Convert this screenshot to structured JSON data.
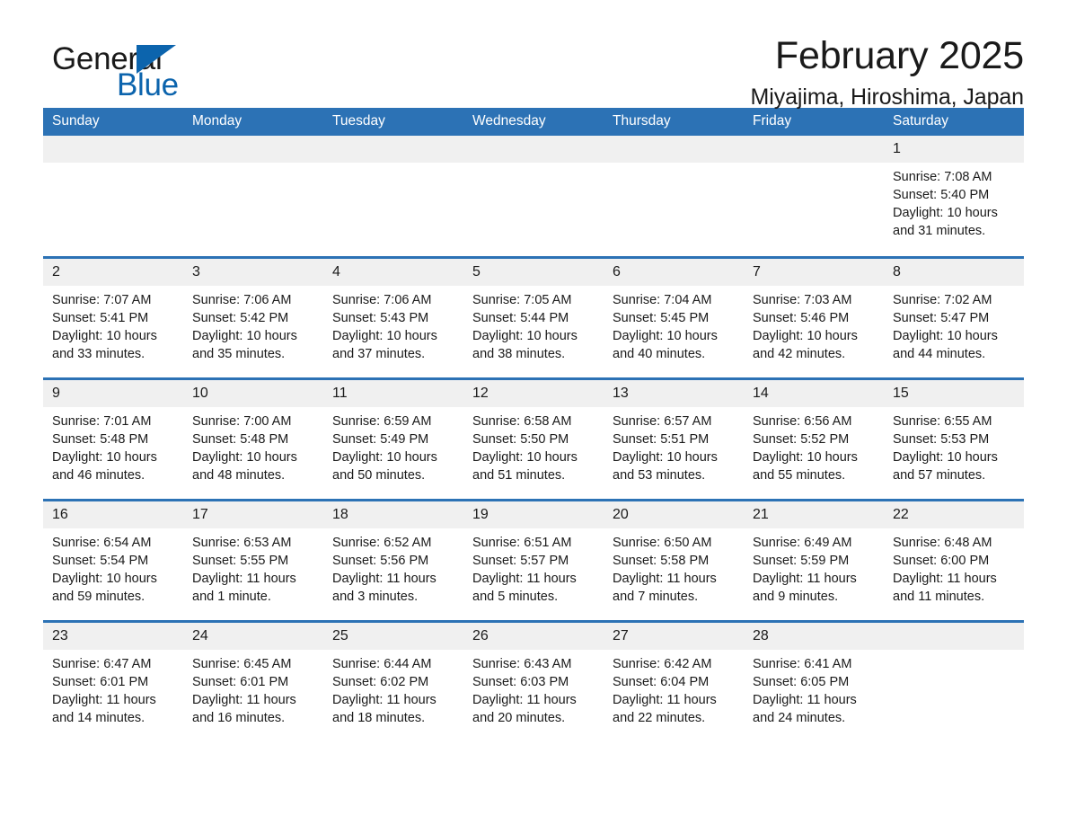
{
  "brand": {
    "word_one": "General",
    "word_two": "Blue",
    "triangle_color": "#0c64ad",
    "icon": "general-blue-logo"
  },
  "header": {
    "month_title": "February 2025",
    "location": "Miyajima, Hiroshima, Japan"
  },
  "theme": {
    "accent_blue": "#2c72b5",
    "logo_blue": "#0c64ad",
    "daynum_band": "#f0f0f0",
    "text": "#1a1a1a"
  },
  "weekdays": [
    "Sunday",
    "Monday",
    "Tuesday",
    "Wednesday",
    "Thursday",
    "Friday",
    "Saturday"
  ],
  "labels": {
    "sunrise_prefix": "Sunrise:",
    "sunset_prefix": "Sunset:",
    "daylight_prefix": "Daylight:"
  },
  "weeks": [
    [
      {
        "day": "",
        "blank": true
      },
      {
        "day": "",
        "blank": true
      },
      {
        "day": "",
        "blank": true
      },
      {
        "day": "",
        "blank": true
      },
      {
        "day": "",
        "blank": true
      },
      {
        "day": "",
        "blank": true
      },
      {
        "day": "1",
        "sunrise": "Sunrise: 7:08 AM",
        "sunset": "Sunset: 5:40 PM",
        "daylight": "Daylight: 10 hours and 31 minutes."
      }
    ],
    [
      {
        "day": "2",
        "sunrise": "Sunrise: 7:07 AM",
        "sunset": "Sunset: 5:41 PM",
        "daylight": "Daylight: 10 hours and 33 minutes."
      },
      {
        "day": "3",
        "sunrise": "Sunrise: 7:06 AM",
        "sunset": "Sunset: 5:42 PM",
        "daylight": "Daylight: 10 hours and 35 minutes."
      },
      {
        "day": "4",
        "sunrise": "Sunrise: 7:06 AM",
        "sunset": "Sunset: 5:43 PM",
        "daylight": "Daylight: 10 hours and 37 minutes."
      },
      {
        "day": "5",
        "sunrise": "Sunrise: 7:05 AM",
        "sunset": "Sunset: 5:44 PM",
        "daylight": "Daylight: 10 hours and 38 minutes."
      },
      {
        "day": "6",
        "sunrise": "Sunrise: 7:04 AM",
        "sunset": "Sunset: 5:45 PM",
        "daylight": "Daylight: 10 hours and 40 minutes."
      },
      {
        "day": "7",
        "sunrise": "Sunrise: 7:03 AM",
        "sunset": "Sunset: 5:46 PM",
        "daylight": "Daylight: 10 hours and 42 minutes."
      },
      {
        "day": "8",
        "sunrise": "Sunrise: 7:02 AM",
        "sunset": "Sunset: 5:47 PM",
        "daylight": "Daylight: 10 hours and 44 minutes."
      }
    ],
    [
      {
        "day": "9",
        "sunrise": "Sunrise: 7:01 AM",
        "sunset": "Sunset: 5:48 PM",
        "daylight": "Daylight: 10 hours and 46 minutes."
      },
      {
        "day": "10",
        "sunrise": "Sunrise: 7:00 AM",
        "sunset": "Sunset: 5:48 PM",
        "daylight": "Daylight: 10 hours and 48 minutes."
      },
      {
        "day": "11",
        "sunrise": "Sunrise: 6:59 AM",
        "sunset": "Sunset: 5:49 PM",
        "daylight": "Daylight: 10 hours and 50 minutes."
      },
      {
        "day": "12",
        "sunrise": "Sunrise: 6:58 AM",
        "sunset": "Sunset: 5:50 PM",
        "daylight": "Daylight: 10 hours and 51 minutes."
      },
      {
        "day": "13",
        "sunrise": "Sunrise: 6:57 AM",
        "sunset": "Sunset: 5:51 PM",
        "daylight": "Daylight: 10 hours and 53 minutes."
      },
      {
        "day": "14",
        "sunrise": "Sunrise: 6:56 AM",
        "sunset": "Sunset: 5:52 PM",
        "daylight": "Daylight: 10 hours and 55 minutes."
      },
      {
        "day": "15",
        "sunrise": "Sunrise: 6:55 AM",
        "sunset": "Sunset: 5:53 PM",
        "daylight": "Daylight: 10 hours and 57 minutes."
      }
    ],
    [
      {
        "day": "16",
        "sunrise": "Sunrise: 6:54 AM",
        "sunset": "Sunset: 5:54 PM",
        "daylight": "Daylight: 10 hours and 59 minutes."
      },
      {
        "day": "17",
        "sunrise": "Sunrise: 6:53 AM",
        "sunset": "Sunset: 5:55 PM",
        "daylight": "Daylight: 11 hours and 1 minute."
      },
      {
        "day": "18",
        "sunrise": "Sunrise: 6:52 AM",
        "sunset": "Sunset: 5:56 PM",
        "daylight": "Daylight: 11 hours and 3 minutes."
      },
      {
        "day": "19",
        "sunrise": "Sunrise: 6:51 AM",
        "sunset": "Sunset: 5:57 PM",
        "daylight": "Daylight: 11 hours and 5 minutes."
      },
      {
        "day": "20",
        "sunrise": "Sunrise: 6:50 AM",
        "sunset": "Sunset: 5:58 PM",
        "daylight": "Daylight: 11 hours and 7 minutes."
      },
      {
        "day": "21",
        "sunrise": "Sunrise: 6:49 AM",
        "sunset": "Sunset: 5:59 PM",
        "daylight": "Daylight: 11 hours and 9 minutes."
      },
      {
        "day": "22",
        "sunrise": "Sunrise: 6:48 AM",
        "sunset": "Sunset: 6:00 PM",
        "daylight": "Daylight: 11 hours and 11 minutes."
      }
    ],
    [
      {
        "day": "23",
        "sunrise": "Sunrise: 6:47 AM",
        "sunset": "Sunset: 6:01 PM",
        "daylight": "Daylight: 11 hours and 14 minutes."
      },
      {
        "day": "24",
        "sunrise": "Sunrise: 6:45 AM",
        "sunset": "Sunset: 6:01 PM",
        "daylight": "Daylight: 11 hours and 16 minutes."
      },
      {
        "day": "25",
        "sunrise": "Sunrise: 6:44 AM",
        "sunset": "Sunset: 6:02 PM",
        "daylight": "Daylight: 11 hours and 18 minutes."
      },
      {
        "day": "26",
        "sunrise": "Sunrise: 6:43 AM",
        "sunset": "Sunset: 6:03 PM",
        "daylight": "Daylight: 11 hours and 20 minutes."
      },
      {
        "day": "27",
        "sunrise": "Sunrise: 6:42 AM",
        "sunset": "Sunset: 6:04 PM",
        "daylight": "Daylight: 11 hours and 22 minutes."
      },
      {
        "day": "28",
        "sunrise": "Sunrise: 6:41 AM",
        "sunset": "Sunset: 6:05 PM",
        "daylight": "Daylight: 11 hours and 24 minutes."
      },
      {
        "day": "",
        "blank": true
      }
    ]
  ]
}
